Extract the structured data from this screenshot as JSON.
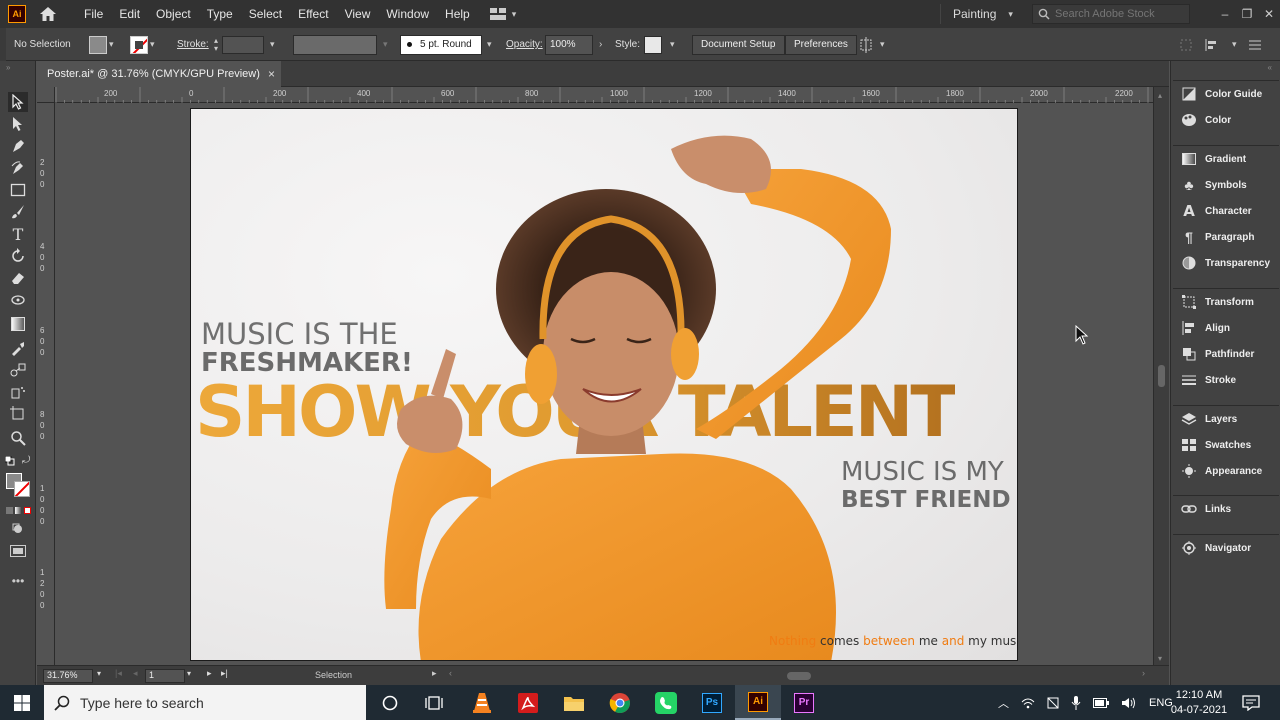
{
  "app": {
    "logo_text": "Ai",
    "menus": [
      "File",
      "Edit",
      "Object",
      "Type",
      "Select",
      "Effect",
      "View",
      "Window",
      "Help"
    ],
    "workspace": "Painting",
    "stock_search_placeholder": "Search Adobe Stock"
  },
  "control_bar": {
    "selection": "No Selection",
    "stroke_label": "Stroke:",
    "brush": "5 pt. Round",
    "opacity_label": "Opacity:",
    "opacity_value": "100%",
    "style_label": "Style:",
    "document_setup": "Document Setup",
    "preferences": "Preferences"
  },
  "document": {
    "tab_title": "Poster.ai* @ 31.76% (CMYK/GPU Preview)",
    "close": "×",
    "zoom": "31.76%",
    "artboard_num": "1",
    "status_tool": "Selection"
  },
  "rulers": {
    "h_ticks": [
      "200",
      "0",
      "200",
      "400",
      "600",
      "800",
      "1000",
      "1200",
      "1400",
      "1600",
      "1800",
      "2000",
      "2200"
    ],
    "v_ticks": [
      "2\n0\n0",
      "4\n0\n0",
      "6\n0\n0",
      "8\n0\n0",
      "1\n0\n0\n0",
      "1\n2\n0\n0"
    ]
  },
  "poster": {
    "line1": "MUSIC IS THE",
    "line2": "FRESHMAKER!",
    "headline": "SHOW YOUR TALENT",
    "right1": "MUSIC IS MY",
    "right2": "BEST FRIEND",
    "tagline_words": [
      "Nothing",
      "comes",
      "between",
      "me",
      "and",
      "my",
      "music"
    ],
    "colors": {
      "orange": "#e8a33a",
      "brown": "#b67623",
      "gray": "#707070",
      "accent_word": "#f07c12"
    }
  },
  "panels": [
    [
      "Color Guide",
      "Color"
    ],
    [
      "Gradient",
      "Symbols",
      "Character",
      "Paragraph",
      "Transparency"
    ],
    [
      "Transform",
      "Align",
      "Pathfinder",
      "Stroke"
    ],
    [
      "Layers",
      "Swatches",
      "Appearance"
    ],
    [
      "Links"
    ],
    [
      "Navigator"
    ]
  ],
  "taskbar": {
    "search_placeholder": "Type here to search",
    "language": "ENG",
    "time": "12:10 AM",
    "date": "04-07-2021"
  }
}
